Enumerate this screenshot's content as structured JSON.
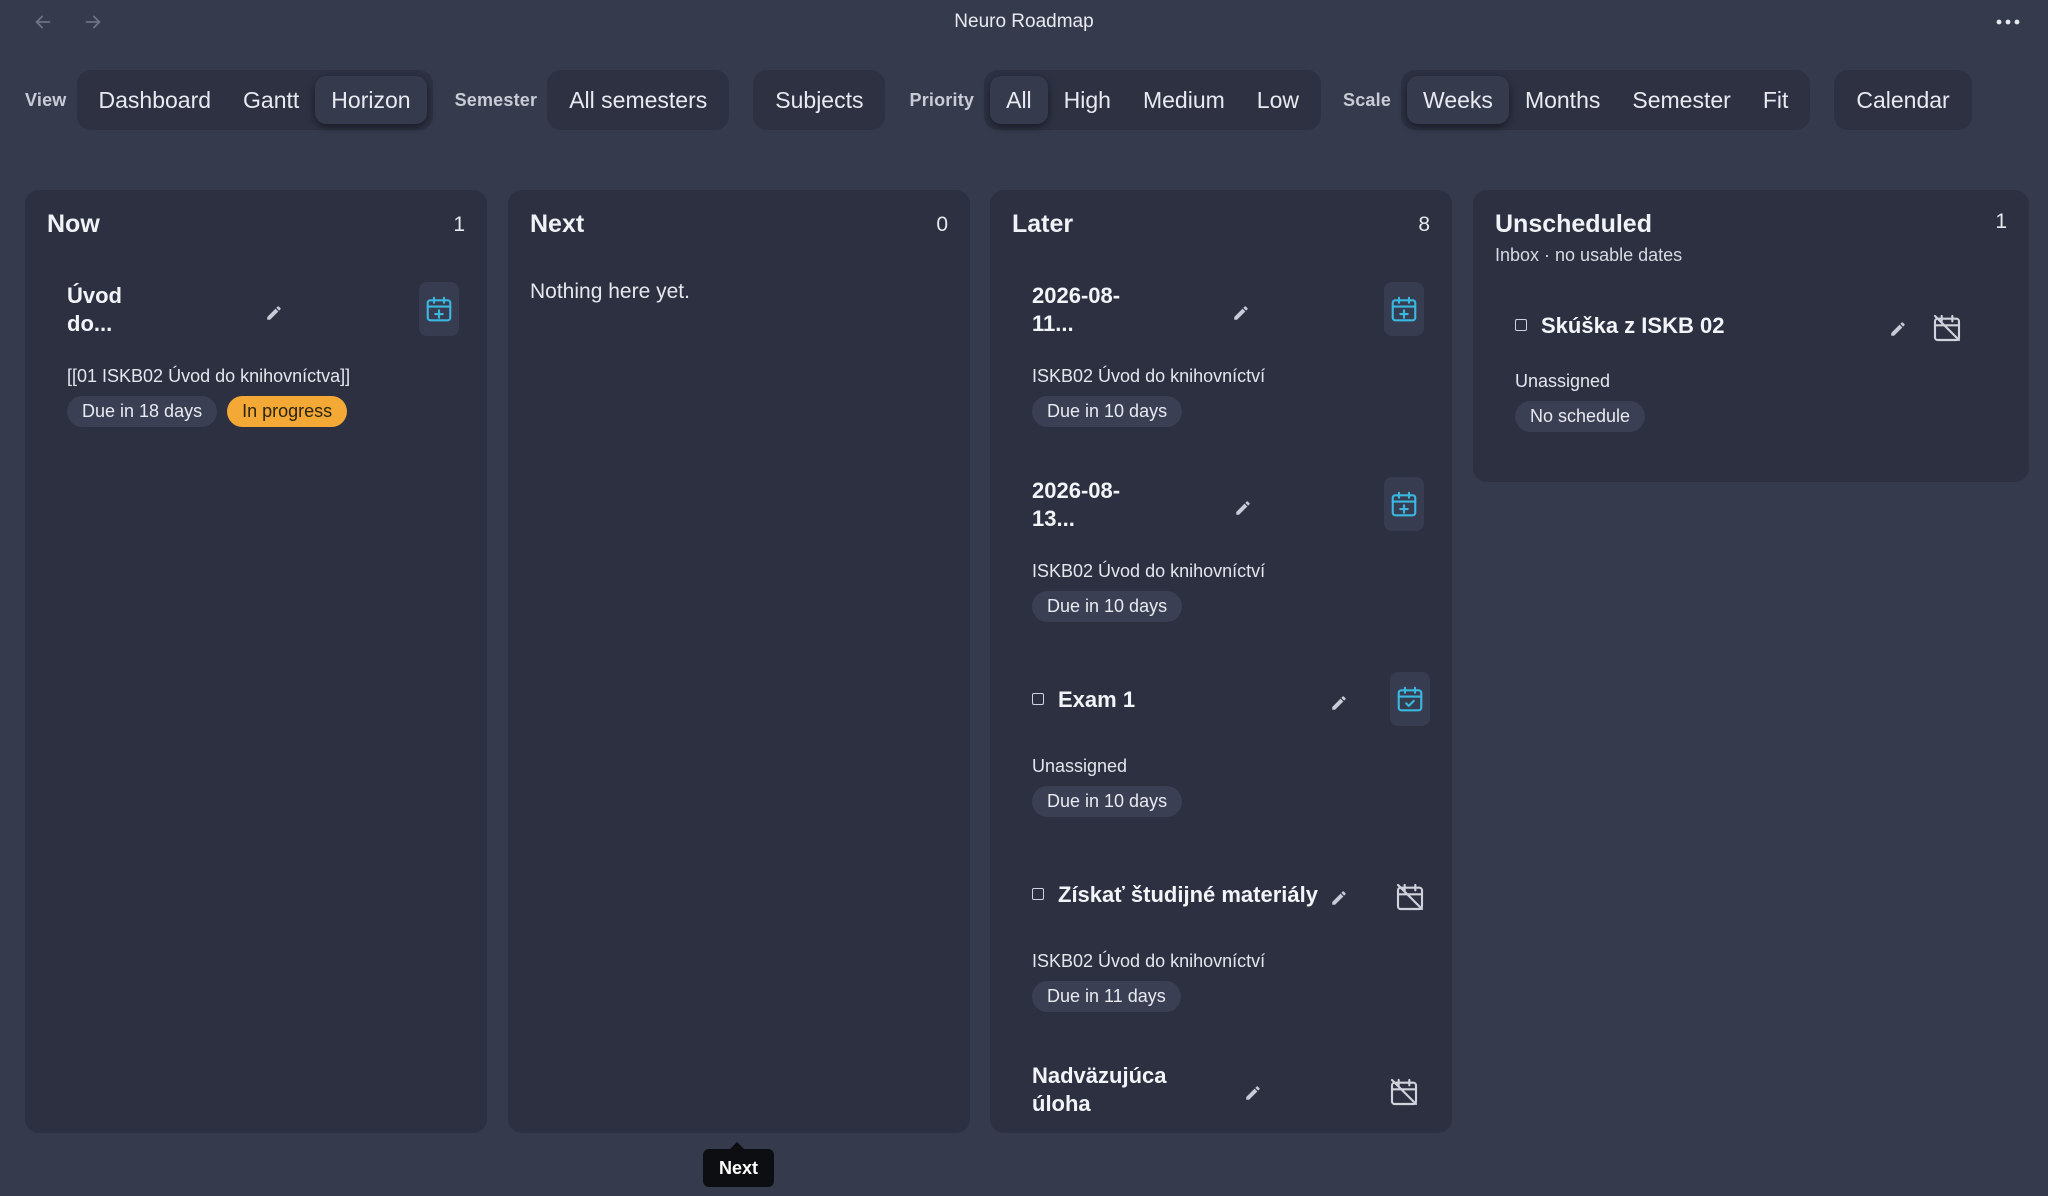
{
  "window": {
    "title": "Neuro Roadmap"
  },
  "toolbar": {
    "view_label": "View",
    "view_options": [
      "Dashboard",
      "Gantt",
      "Horizon"
    ],
    "view_active": "Horizon",
    "semester_label": "Semester",
    "semester_value": "All semesters",
    "subjects_label": "Subjects",
    "priority_label": "Priority",
    "priority_options": [
      "All",
      "High",
      "Medium",
      "Low"
    ],
    "priority_active": "All",
    "scale_label": "Scale",
    "scale_options": [
      "Weeks",
      "Months",
      "Semester",
      "Fit"
    ],
    "scale_active": "Weeks",
    "calendar_label": "Calendar"
  },
  "columns": {
    "now": {
      "title": "Now",
      "count": "1",
      "cards": [
        {
          "title_line1": "Úvod",
          "title_line2": "do...",
          "subtitle": "[[01 ISKB02 Úvod do knihovníctva]]",
          "due": "Due in 18 days",
          "status": "In progress"
        }
      ]
    },
    "next": {
      "title": "Next",
      "count": "0",
      "empty": "Nothing here yet."
    },
    "later": {
      "title": "Later",
      "count": "8",
      "cards": [
        {
          "title_line1": "2026-08-",
          "title_line2": "11...",
          "subtitle": "ISKB02 Úvod do knihovníctví",
          "due": "Due in 10 days"
        },
        {
          "title_line1": "2026-08-",
          "title_line2": "13...",
          "subtitle": "ISKB02 Úvod do knihovníctví",
          "due": "Due in 10 days"
        },
        {
          "title": "Exam 1",
          "subtitle": "Unassigned",
          "due": "Due in 10 days"
        },
        {
          "title": "Získať študijné materiály",
          "subtitle": "ISKB02 Úvod do knihovníctví",
          "due": "Due in 11 days"
        },
        {
          "title_line1": "Nadväzujúca",
          "title_line2": "úloha"
        }
      ]
    },
    "unscheduled": {
      "title": "Unscheduled",
      "count": "1",
      "subtitle": "Inbox · no usable dates",
      "cards": [
        {
          "title": "Skúška z ISKB 02",
          "subtitle": "Unassigned",
          "schedule": "No schedule"
        }
      ]
    }
  },
  "tooltip": {
    "text": "Next"
  },
  "colors": {
    "background": "#353a4d",
    "panel": "#2c3040",
    "accent_calendar": "#3ab8e0",
    "status_in_progress": "#f4a936"
  },
  "icons": {
    "back": "arrow-left-icon",
    "forward": "arrow-right-icon",
    "more": "more-horizontal-icon",
    "edit": "pencil-icon",
    "calendar_add": "calendar-plus-icon",
    "calendar_check": "calendar-check-icon",
    "calendar_off": "calendar-off-icon"
  }
}
